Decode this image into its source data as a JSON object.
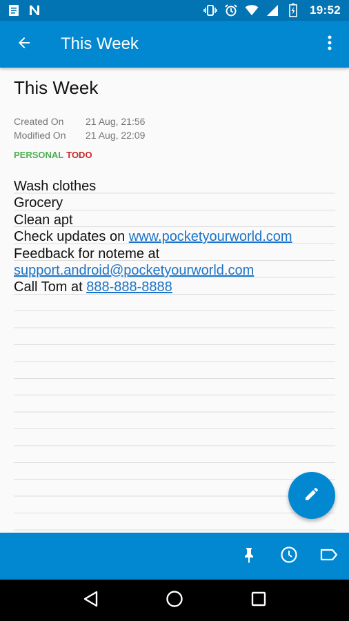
{
  "status_bar": {
    "time": "19:52",
    "left_icons": [
      "notes-notification-icon",
      "n-notification-icon"
    ],
    "right_icons": [
      "vibrate-icon",
      "alarm-icon",
      "wifi-icon",
      "signal-icon",
      "battery-icon"
    ]
  },
  "app_bar": {
    "title": "This Week",
    "background": "#0288d1"
  },
  "note": {
    "title": "This Week",
    "created_label": "Created On",
    "created_value": "21 Aug, 21:56",
    "modified_label": "Modified On",
    "modified_value": "21 Aug, 22:09",
    "tags": [
      {
        "label": "PERSONAL",
        "color": "#4caf50"
      },
      {
        "label": "TODO",
        "color": "#c62828"
      }
    ],
    "lines": {
      "l1": "Wash clothes",
      "l2": "Grocery",
      "l3": "Clean apt",
      "l4_text": "Check updates on ",
      "l4_link": "www.pocketyourworld.com",
      "l5": "Feedback for noteme at",
      "l6_link": "support.android@pocketyourworld.com",
      "l7_text": "Call Tom at ",
      "l7_link": "888-888-8888"
    }
  },
  "fab": {
    "icon": "pencil-icon"
  },
  "toolbar": {
    "icons": [
      "pin-icon",
      "clock-icon",
      "label-icon"
    ]
  },
  "nav": {
    "icons": [
      "back-triangle-icon",
      "home-circle-icon",
      "recents-square-icon"
    ]
  }
}
